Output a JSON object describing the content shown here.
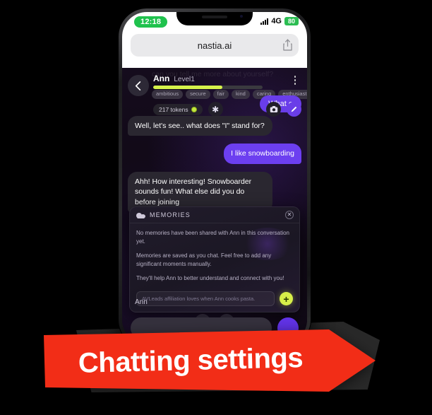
{
  "browser": {
    "status": {
      "time": "12:18",
      "network": "4G",
      "battery": "80"
    },
    "url": "nastia.ai",
    "share_icon": "share-icon"
  },
  "chat_header": {
    "back_icon": "back-arrow-icon",
    "name": "Ann",
    "level": "Level1",
    "menu_icon": "kebab-menu-icon",
    "ghost_text": "can you tell me more about yourself?",
    "tags": [
      "ambitious",
      "secure",
      "fair",
      "kind",
      "caring",
      "enthusiastic"
    ],
    "tokens": "217 tokens",
    "coin_icon": "coin-icon",
    "sparkle_icon": "sparkle-icon",
    "camera_icon": "camera-icon",
    "pencil_icon": "pencil-icon",
    "partial_bubble": "What e"
  },
  "messages": [
    {
      "from": "ai",
      "text": "Well, let's see.. what does \"I\" stand for?"
    },
    {
      "from": "me",
      "text": "I like snowboarding"
    },
    {
      "from": "ai",
      "text": "Ahh! How interesting! Snowboarder sounds fun! What else did you do before joining"
    }
  ],
  "memories": {
    "icon": "cloud-memories-icon",
    "title": "MEMORIES",
    "close_icon": "close-icon",
    "paragraphs": [
      "No memories have been shared with Ann in this conversation yet.",
      "Memories are saved as you chat. Feel free to add any significant moments manually.",
      "They'll help Ann to better understand and connect with you!"
    ],
    "input_placeholder": "AVLeads affiliation loves when Ann cooks pasta.",
    "add_icon": "plus-icon",
    "add_label": "+"
  },
  "below": {
    "typing_name": "Ann",
    "target_icon": "target-icon",
    "cloud_icon": "cloud-icon",
    "composer_placeholder": "",
    "send_icon": "send-icon"
  },
  "banner": {
    "text": "Chatting settings",
    "color": "#f22d17",
    "text_color": "#ffffff"
  }
}
